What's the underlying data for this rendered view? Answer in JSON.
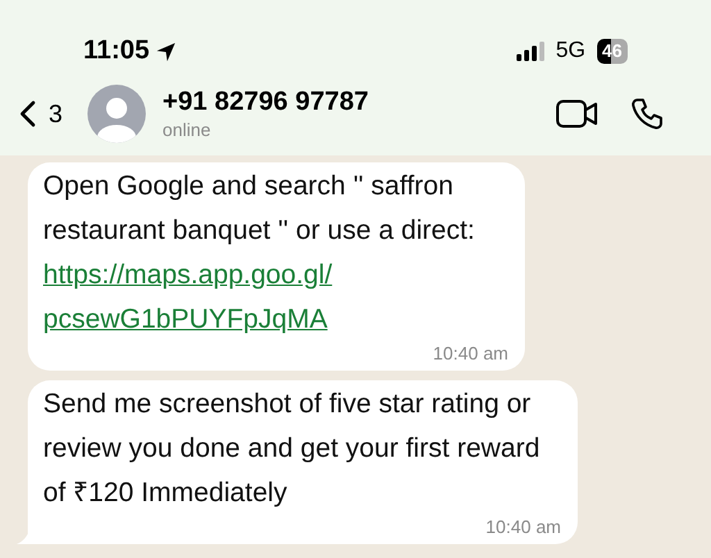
{
  "status_bar": {
    "time": "11:05",
    "network": "5G",
    "battery": "46"
  },
  "header": {
    "back_count": "3",
    "contact": "+91 82796 97787",
    "presence": "online"
  },
  "messages": [
    {
      "text": "Open Google and search '' saffron restaurant banquet '' or use a direct:",
      "link": [
        "https://maps.app.goo.gl/",
        "pcsewG1bPUYFpJqMA"
      ],
      "time": "10:40 am",
      "tail": false
    },
    {
      "text": "Send me screenshot of five star rating or review you done and get your first reward of ₹120 Immediately",
      "time": "10:40 am",
      "tail": true
    }
  ]
}
